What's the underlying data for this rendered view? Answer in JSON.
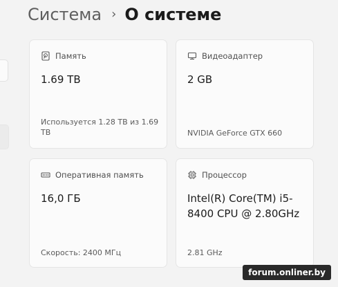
{
  "breadcrumb": {
    "parent": "Система",
    "separator": "›",
    "current": "О системе"
  },
  "cards": {
    "storage": {
      "icon": "storage-icon",
      "title": "Память",
      "value": "1.69 TB",
      "detail": "Используется 1.28 TB из 1.69 TB"
    },
    "gpu": {
      "icon": "gpu-icon",
      "title": "Видеоадаптер",
      "value": "2 GB",
      "detail": "NVIDIA GeForce GTX 660"
    },
    "ram": {
      "icon": "ram-icon",
      "title": "Оперативная память",
      "value": "16,0 ГБ",
      "detail": "Скорость: 2400 МГц"
    },
    "cpu": {
      "icon": "cpu-icon",
      "title": "Процессор",
      "value": "Intel(R) Core(TM) i5-8400 CPU @ 2.80GHz",
      "detail": "2.81 GHz"
    }
  },
  "watermark": "forum.onliner.by"
}
